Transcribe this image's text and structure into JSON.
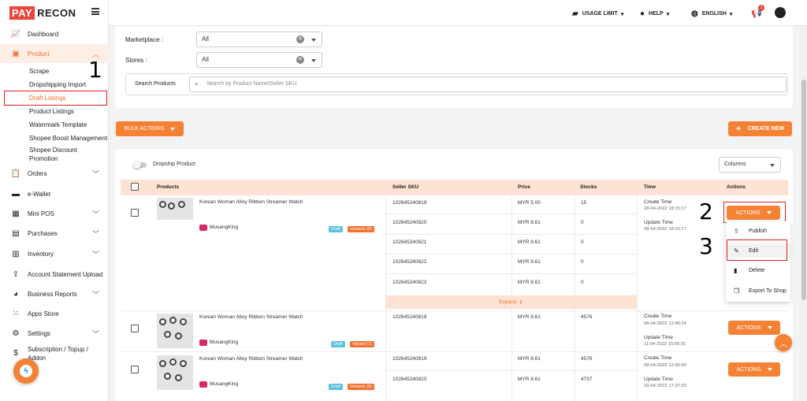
{
  "brand": {
    "pay": "PAY",
    "recon": "RECON"
  },
  "sidebar": {
    "items": [
      {
        "label": "Dashboard",
        "icon": "chart-icon"
      },
      {
        "label": "Product",
        "icon": "box-icon"
      },
      {
        "label": "Orders",
        "icon": "clipboard-icon"
      },
      {
        "label": "e-Wallet",
        "icon": "wallet-icon"
      },
      {
        "label": "Mini POS",
        "icon": "store-icon"
      },
      {
        "label": "Purchases",
        "icon": "truck-icon"
      },
      {
        "label": "Inventory",
        "icon": "warehouse-icon"
      },
      {
        "label": "Account Statement Upload",
        "icon": "upload-icon"
      },
      {
        "label": "Business Reports",
        "icon": "pie-chart-icon"
      },
      {
        "label": "Apps Store",
        "icon": "grid-icon"
      },
      {
        "label": "Settings",
        "icon": "gear-icon"
      },
      {
        "label": "Subscription / Topup /",
        "label2": "Addon",
        "icon": "dollar-icon"
      }
    ],
    "product_sub": [
      "Scrape",
      "Dropshipping Import",
      "Draft Listings",
      "Product Listings",
      "Watermark Template",
      "Shopee Boost Management",
      "Shopee Discount",
      "Promotion"
    ]
  },
  "topbar": {
    "usage": "USAGE LIMIT",
    "help": "HELP",
    "lang": "ENGLISH",
    "notif_count": "1"
  },
  "filters": {
    "marketplace_label": "Marketplace :",
    "marketplace_value": "All",
    "stores_label": "Stores :",
    "stores_value": "All",
    "search_label": "Search Products",
    "search_placeholder": "Search by Product Name/Seller SKU"
  },
  "actions": {
    "bulk": "BULK ACTIONS",
    "create": "CREATE NEW",
    "dropship": "Dropship Product",
    "columns": "Columns"
  },
  "table": {
    "headers": [
      "Products",
      "Seller SKU",
      "Price",
      "Stocks",
      "Time",
      "Actions"
    ],
    "actions_btn": "ACTIONS",
    "expand": "Expand",
    "rows": [
      {
        "name": "Korean Woman Alloy Ribbon Streamer Watch",
        "shop": "MusangKing",
        "status": "Draft",
        "variants": "Variants (8)",
        "create_label": "Create Time",
        "create_time": "28-04-2022 18:15:17",
        "update_label": "Update Time",
        "update_time": "28-04-2022 18:15:17",
        "skus": [
          {
            "sku": "102645240819",
            "price": "MYR 5.00",
            "stock": "15"
          },
          {
            "sku": "102645240820",
            "price": "MYR 8.61",
            "stock": "0"
          },
          {
            "sku": "102645240821",
            "price": "MYR 8.61",
            "stock": "0"
          },
          {
            "sku": "102645240822",
            "price": "MYR 8.61",
            "stock": "0"
          },
          {
            "sku": "102645240823",
            "price": "MYR 8.61",
            "stock": "0"
          }
        ]
      },
      {
        "name": "Korean Woman Alloy Ribbon Streamer Watch",
        "shop": "MusangKing",
        "status": "Draft",
        "variants": "Variant (1)",
        "create_label": "Create Time",
        "create_time": "08-04-2022 12:46:24",
        "update_label": "Update Time",
        "update_time": "11-04-2022 15:05:31",
        "skus": [
          {
            "sku": "102645240819",
            "price": "MYR 8.61",
            "stock": "4576"
          }
        ]
      },
      {
        "name": "Korean Woman Alloy Ribbon Streamer Watch",
        "shop": "MusangKing",
        "status": "Draft",
        "variants": "Variants (8)",
        "create_label": "Create Time",
        "create_time": "08-04-2022 12:45:40",
        "update_label": "Update Time",
        "update_time": "20-04-2022 17:37:33",
        "skus": [
          {
            "sku": "102645240819",
            "price": "MYR 8.61",
            "stock": "4576"
          },
          {
            "sku": "102645240820",
            "price": "MYR 8.61",
            "stock": "4737"
          }
        ]
      }
    ]
  },
  "menu": [
    "Publish",
    "Edit",
    "Delete",
    "Export To Shop"
  ],
  "steps": [
    "1",
    "2",
    "3"
  ],
  "colors": {
    "accent": "#f58234",
    "annotation": "#e31b23",
    "draft": "#5bc0de",
    "variants": "#f07030"
  }
}
